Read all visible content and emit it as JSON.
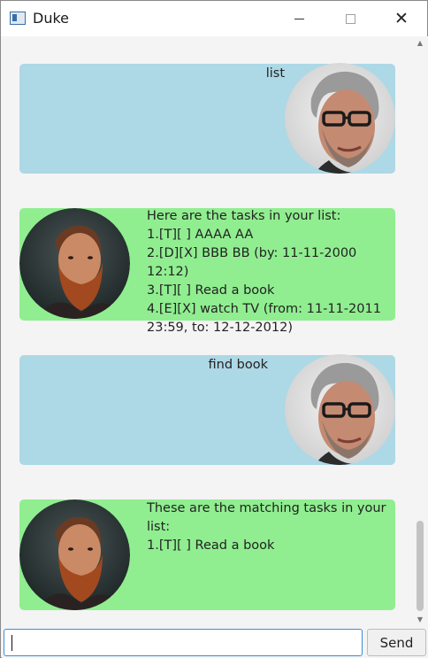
{
  "window": {
    "title": "Duke",
    "app_icon": "java-window-icon",
    "controls": {
      "minimize": "minimize-icon",
      "maximize": "maximize-icon",
      "close": "close-icon"
    }
  },
  "colors": {
    "user_bubble": "#add8e6",
    "duke_bubble": "#90ee90",
    "input_focus_border": "#3b8fd8"
  },
  "messages": [
    {
      "sender": "user",
      "avatar": "user-avatar",
      "text": "list"
    },
    {
      "sender": "duke",
      "avatar": "duke-avatar",
      "text": "Here are the tasks in your list:\n1.[T][ ] AAAA AA\n2.[D][X] BBB BB (by: 11-11-2000 12:12)\n3.[T][ ] Read a book\n4.[E][X] watch TV (from: 11-11-2011\n23:59, to: 12-12-2012)"
    },
    {
      "sender": "user",
      "avatar": "user-avatar",
      "text": "find book"
    },
    {
      "sender": "duke",
      "avatar": "duke-avatar",
      "text": "These are the matching tasks in your\nlist:\n1.[T][ ] Read a book"
    }
  ],
  "input": {
    "value": "",
    "placeholder": ""
  },
  "send_button": {
    "label": "Send"
  }
}
